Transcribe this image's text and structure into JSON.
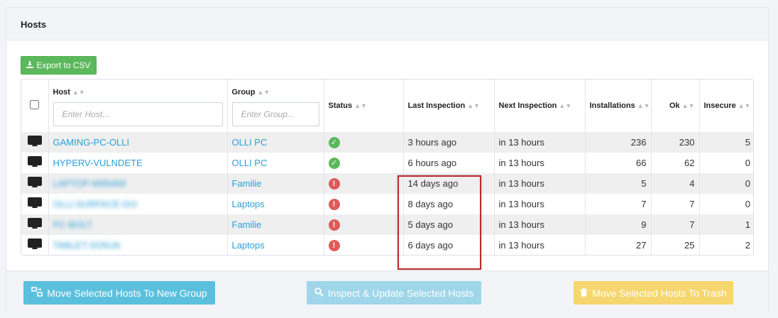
{
  "panel": {
    "title": "Hosts"
  },
  "toolbar": {
    "export_label": "Export to CSV"
  },
  "table": {
    "headers": {
      "host": "Host",
      "group": "Group",
      "status": "Status",
      "last_inspection": "Last Inspection",
      "next_inspection": "Next Inspection",
      "installations": "Installations",
      "ok": "Ok",
      "insecure": "Insecure"
    },
    "filters": {
      "host_placeholder": "Enter Host...",
      "group_placeholder": "Enter Group..."
    },
    "rows": [
      {
        "host": "GAMING-PC-OLLI",
        "host_blurred": false,
        "group": "OLLI PC",
        "status": "ok",
        "last_inspection": "3 hours ago",
        "next_inspection": "in 13 hours",
        "installations": "236",
        "ok": "230",
        "insecure": "5"
      },
      {
        "host": "HYPERV-VULNDETE",
        "host_blurred": false,
        "group": "OLLI PC",
        "status": "ok",
        "last_inspection": "6 hours ago",
        "next_inspection": "in 13 hours",
        "installations": "66",
        "ok": "62",
        "insecure": "0"
      },
      {
        "host": "LAPTOP-MIRIAM",
        "host_blurred": true,
        "group": "Familie",
        "status": "error",
        "last_inspection": "14 days ago",
        "next_inspection": "in 13 hours",
        "installations": "5",
        "ok": "4",
        "insecure": "0"
      },
      {
        "host": "OLLI-SURFACE-GO",
        "host_blurred": true,
        "group": "Laptops",
        "status": "error",
        "last_inspection": "8 days ago",
        "next_inspection": "in 13 hours",
        "installations": "7",
        "ok": "7",
        "insecure": "0"
      },
      {
        "host": "PC-BOLT",
        "host_blurred": true,
        "group": "Familie",
        "status": "error",
        "last_inspection": "5 days ago",
        "next_inspection": "in 13 hours",
        "installations": "9",
        "ok": "7",
        "insecure": "1"
      },
      {
        "host": "TABLET-SONJA",
        "host_blurred": true,
        "group": "Laptops",
        "status": "error",
        "last_inspection": "6 days ago",
        "next_inspection": "in 13 hours",
        "installations": "27",
        "ok": "25",
        "insecure": "2"
      }
    ]
  },
  "footer": {
    "move_group_label": "Move Selected Hosts To New Group",
    "inspect_label": "Inspect & Update Selected Hosts",
    "trash_label": "Move Selected Hosts To Trash"
  },
  "icons": {
    "export": "download-icon",
    "host": "desktop-icon",
    "status_ok": "check-circle-icon",
    "status_error": "exclamation-circle-icon",
    "move": "move-group-icon",
    "inspect": "search-icon",
    "trash": "trash-icon"
  },
  "colors": {
    "export_button": "#5cb85c",
    "link": "#2a9fd6",
    "status_ok": "#5cb85c",
    "status_error": "#e05a5a",
    "move_button": "#5bc0de",
    "inspect_button": "#9fd6ea",
    "trash_button": "#f6d66e",
    "highlight_box": "#c0292b"
  }
}
